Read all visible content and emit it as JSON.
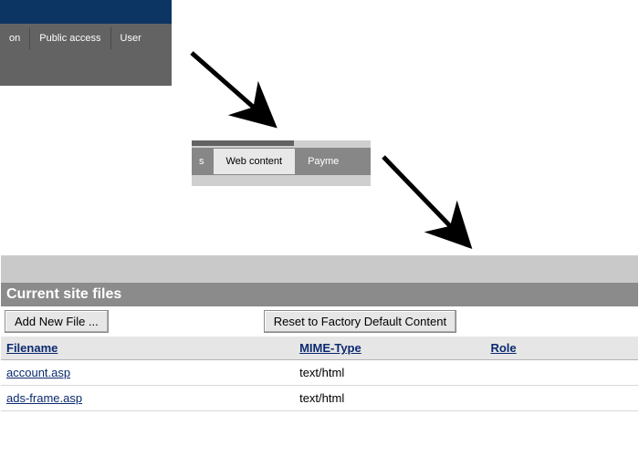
{
  "topnav": {
    "items": [
      "on",
      "Public access",
      "User"
    ]
  },
  "subnav": {
    "left_fragment": "s",
    "active": "Web content",
    "right_fragment": "Payme"
  },
  "panel": {
    "title": "Current site files",
    "buttons": {
      "add": "Add New File ...",
      "reset": "Reset to Factory Default Content"
    },
    "columns": {
      "filename": "Filename",
      "mime": "MIME-Type",
      "role": "Role"
    },
    "rows": [
      {
        "filename": "account.asp",
        "mime": "text/html",
        "role": ""
      },
      {
        "filename": "ads-frame.asp",
        "mime": "text/html",
        "role": ""
      }
    ]
  }
}
